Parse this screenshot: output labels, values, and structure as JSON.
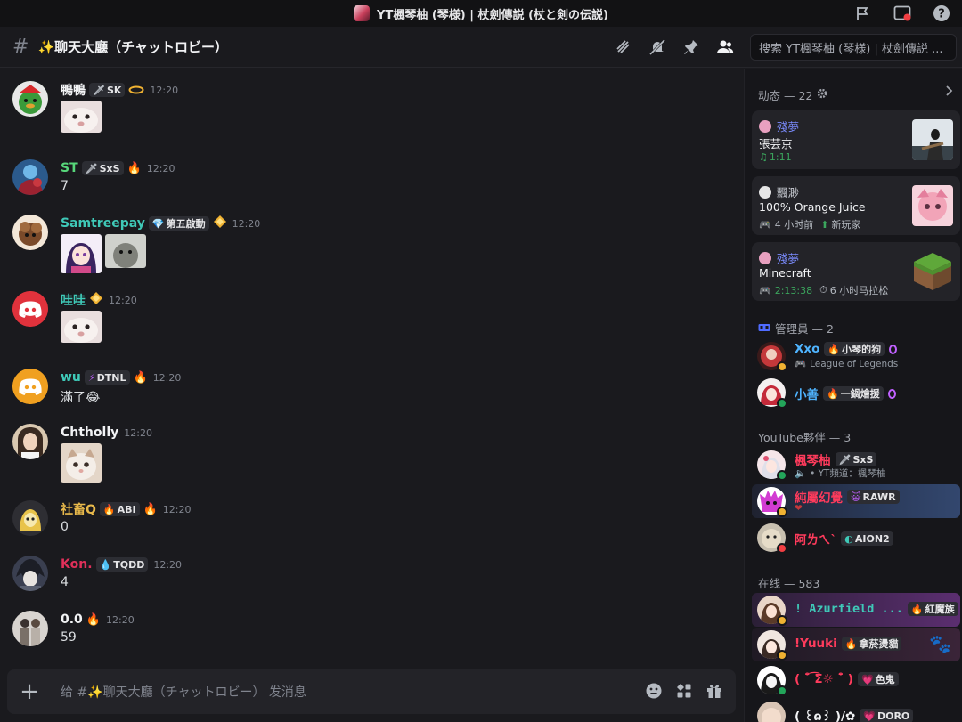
{
  "titlebar": {
    "title": "YT楓琴柚 (琴様) | 杖劍傳説 (杖と剣の伝説)"
  },
  "channel": {
    "name": "✨聊天大廳（チャットロビー）",
    "search_placeholder": "搜索 YT楓琴柚 (琴様) | 杖劍傳説 ..."
  },
  "messages": [
    {
      "user": "鴨鴨",
      "color": "#f2f3f5",
      "tag": "SK",
      "tag_icon": "🗡",
      "ts": "12:20",
      "text": ""
    },
    {
      "user": "ST",
      "color": "#57d67a",
      "tag": "SxS",
      "tag_icon": "🗡",
      "ts": "12:20",
      "text": "7"
    },
    {
      "user": "Samtreepay",
      "color": "#3fc9b8",
      "tag": "第五啟動",
      "tag_icon": "💎",
      "ts": "12:20",
      "text": ""
    },
    {
      "user": "哇哇",
      "color": "#3fc9b8",
      "tag": "",
      "tag_icon": "",
      "ts": "12:20",
      "text": ""
    },
    {
      "user": "wu",
      "color": "#3fc9b8",
      "tag": "DTNL",
      "tag_icon": "⚡",
      "ts": "12:20",
      "text": "滿了😂"
    },
    {
      "user": "Chtholly",
      "color": "#f2f3f5",
      "tag": "",
      "tag_icon": "",
      "ts": "12:20",
      "text": ""
    },
    {
      "user": "社畜Q",
      "color": "#e8b94b",
      "tag": "ABI",
      "tag_icon": "🔥",
      "ts": "12:20",
      "text": "0"
    },
    {
      "user": "Kon.",
      "color": "#e0305a",
      "tag": "TQDD",
      "tag_icon": "💧",
      "ts": "12:20",
      "text": "4"
    },
    {
      "user": "0.0",
      "color": "#f2f3f5",
      "tag": "",
      "tag_icon": "",
      "ts": "12:20",
      "text": "59"
    }
  ],
  "composer": {
    "placeholder": "给 #✨聊天大廳（チャットロビー） 发消息"
  },
  "sidebar": {
    "activity_header": "动态 — 22",
    "activities": [
      {
        "user": "殘夢",
        "user_color": "#7b8cff",
        "title": "張芸京",
        "sub1": "1:11",
        "sub2": ""
      },
      {
        "user": "飄渺",
        "user_color": "#c4c7ce",
        "title": "100% Orange Juice",
        "sub1": "4 小时前",
        "sub2": "新玩家"
      },
      {
        "user": "殘夢",
        "user_color": "#7b8cff",
        "title": "Minecraft",
        "sub1": "2:13:38",
        "sub2": "6 小时马拉松"
      }
    ],
    "admin_header": "管理員 — 2",
    "admins": [
      {
        "name": "Xxo",
        "color": "#4fb4ff",
        "tag": "小琴的狗",
        "sub": "League of Legends"
      },
      {
        "name": "小善",
        "color": "#4fb4ff",
        "tag": "一鍋燴援",
        "sub": ""
      }
    ],
    "partner_header": "YouTube夥伴 — 3",
    "partners": [
      {
        "name": "楓琴柚",
        "color": "#ff3b5c",
        "tag": "SxS",
        "sub": "• YT頻道：楓琴柚"
      },
      {
        "name": "純屬幻覺",
        "color": "#ff3b5c",
        "tag": "RAWR",
        "sub": ""
      },
      {
        "name": "阿ㄌㄟˋ",
        "color": "#ff3b5c",
        "tag": "AION2",
        "sub": ""
      }
    ],
    "online_header": "在线 — 583",
    "online": [
      {
        "name": "! Azurfield ...",
        "color": "#3fc9b8",
        "tag": "紅魔族"
      },
      {
        "name": "!Yuuki",
        "color": "#ff3b5c",
        "tag": "拿菸燙貓"
      },
      {
        "name": "( ¯͒ ͡Ʃ☼ ¯͒ )",
        "color": "#ff3b5c",
        "tag": "色鬼"
      },
      {
        "name": "( ꒰ɷ꒱ )/✿",
        "color": "#f2f3f5",
        "tag": "DORO"
      }
    ]
  }
}
